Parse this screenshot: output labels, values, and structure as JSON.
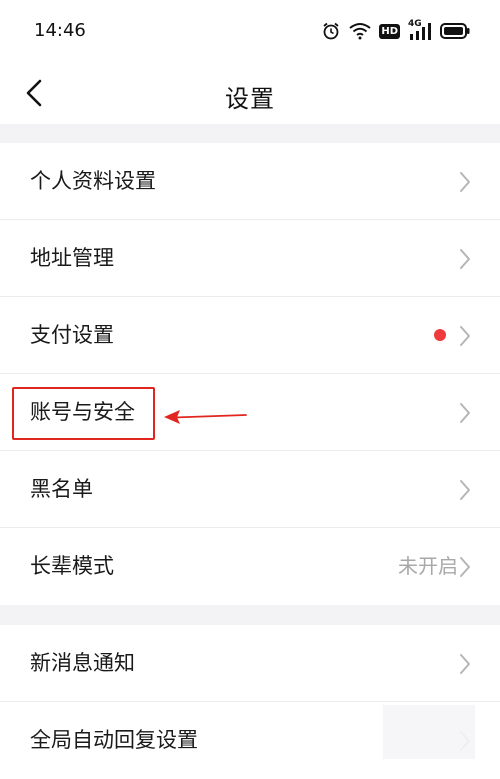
{
  "status_bar": {
    "time": "14:46",
    "icons": [
      "alarm-icon",
      "wifi-icon",
      "hd-icon",
      "4g-signal-icon",
      "battery-icon"
    ],
    "hd_label": "HD",
    "network_label": "4G"
  },
  "nav": {
    "title": "设置",
    "back_icon": "chevron-left-icon"
  },
  "group1": {
    "items": [
      {
        "label": "个人资料设置"
      },
      {
        "label": "地址管理"
      },
      {
        "label": "支付设置",
        "badge": "red-dot"
      },
      {
        "label": "账号与安全",
        "highlighted": true
      },
      {
        "label": "黑名单"
      },
      {
        "label": "长辈模式",
        "value": "未开启"
      }
    ]
  },
  "group2": {
    "items": [
      {
        "label": "新消息通知"
      },
      {
        "label": "全局自动回复设置"
      }
    ]
  },
  "colors": {
    "accent_red": "#ef3b3b",
    "annotation_red": "#e0261f",
    "section_bg": "#f3f3f5",
    "chevron": "#b5b5b5",
    "secondary_text": "#a8a8a8"
  }
}
